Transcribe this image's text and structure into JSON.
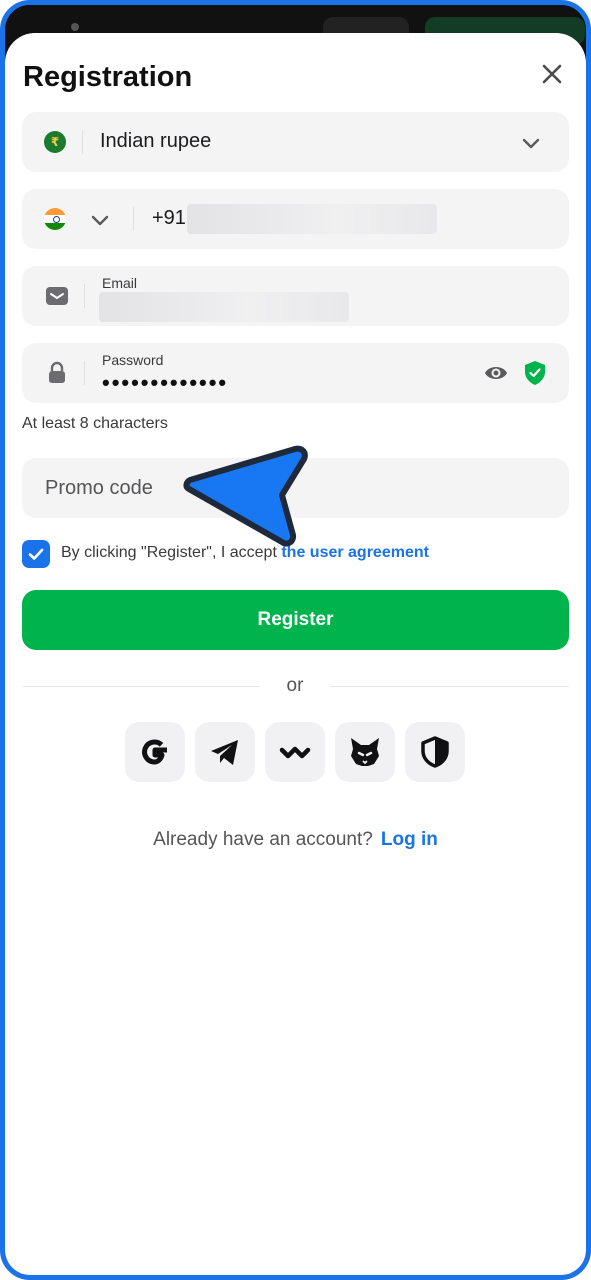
{
  "title": "Registration",
  "currency": {
    "label": "Indian rupee",
    "symbol": "₹"
  },
  "phone": {
    "prefix": "+91"
  },
  "email": {
    "label": "Email"
  },
  "password": {
    "label": "Password",
    "masked_value": "•••••••••••••"
  },
  "password_hint": "At least 8 characters",
  "promo": {
    "placeholder": "Promo code"
  },
  "agreement": {
    "text": "By clicking \"Register\", I accept",
    "link": "the user agreement",
    "checked": true
  },
  "register_label": "Register",
  "or_text": "or",
  "social": [
    "google-icon",
    "telegram-icon",
    "walletconnect-icon",
    "metamask-icon",
    "shield-icon"
  ],
  "login": {
    "prompt": "Already have an account?",
    "link": "Log in"
  },
  "colors": {
    "accent": "#1a73e8",
    "register_green": "#01b34c",
    "field_bg": "#f4f4f5"
  }
}
